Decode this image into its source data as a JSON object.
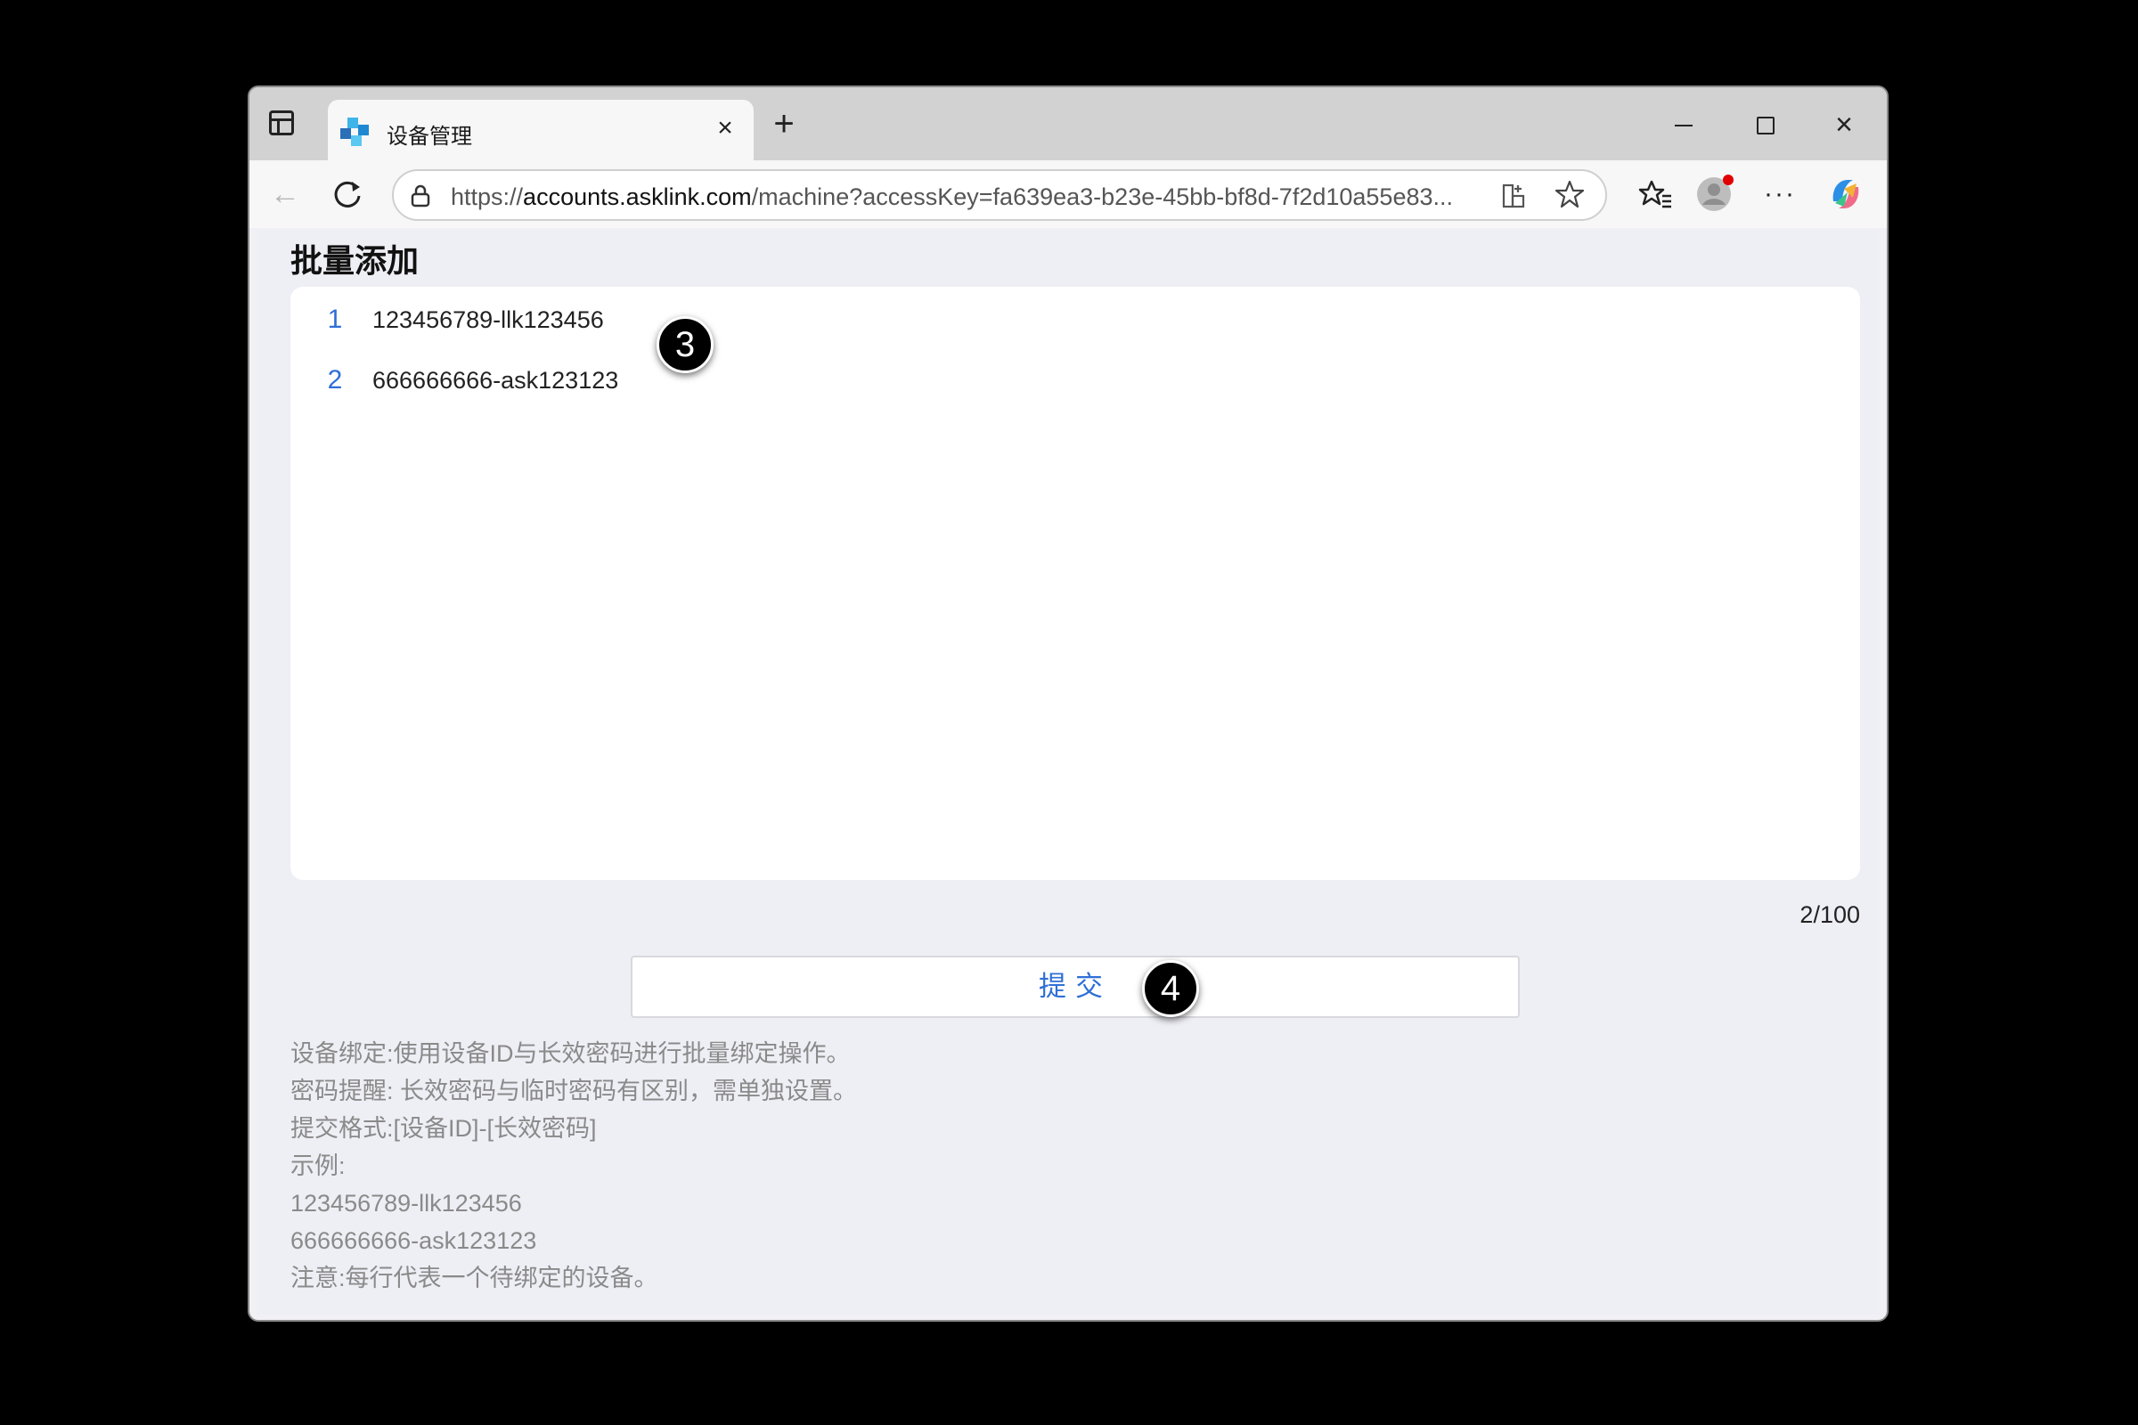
{
  "browser": {
    "tab_title": "设备管理",
    "url_prefix": "https://",
    "url_host": "accounts.asklink.com",
    "url_rest": "/machine?accessKey=fa639ea3-b23e-45bb-bf8d-7f2d10a55e83..."
  },
  "page": {
    "title": "批量添加",
    "lines": [
      {
        "num": "1",
        "text": "123456789-llk123456"
      },
      {
        "num": "2",
        "text": "666666666-ask123123"
      }
    ],
    "counter": "2/100",
    "submit_label": "提交",
    "help": [
      "设备绑定:使用设备ID与长效密码进行批量绑定操作。",
      "密码提醒: 长效密码与临时密码有区别，需单独设置。",
      "提交格式:[设备ID]-[长效密码]",
      "示例:",
      "123456789-llk123456",
      "666666666-ask123123",
      "注意:每行代表一个待绑定的设备。"
    ]
  },
  "markers": [
    "3",
    "4"
  ],
  "colors": {
    "accent": "#2f6fd6",
    "background": "#eeeef5"
  }
}
